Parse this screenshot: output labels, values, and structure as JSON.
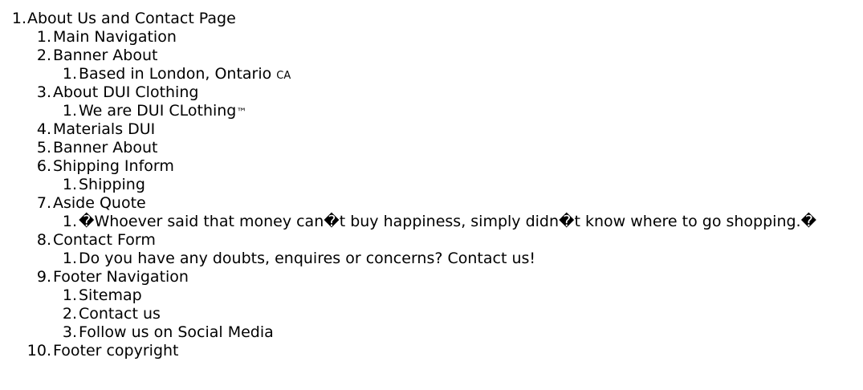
{
  "outline": {
    "title": {
      "num": "1.",
      "text": "About Us and Contact Page"
    },
    "sections": [
      {
        "num": "1.",
        "text": "Main Navigation",
        "children": []
      },
      {
        "num": "2.",
        "text": "Banner About",
        "children": [
          {
            "num": "1.",
            "text": "Based in London, Ontario ",
            "mark": "CA"
          }
        ]
      },
      {
        "num": "3.",
        "text": "About DUI Clothing",
        "children": [
          {
            "num": "1.",
            "text": "We are DUI CLothing",
            "mark": "™"
          }
        ]
      },
      {
        "num": "4.",
        "text": "Materials DUI",
        "children": []
      },
      {
        "num": "5.",
        "text": "Banner About",
        "children": []
      },
      {
        "num": "6.",
        "text": "Shipping Inform",
        "children": [
          {
            "num": "1.",
            "text": "Shipping"
          }
        ]
      },
      {
        "num": "7.",
        "text": "Aside Quote",
        "children": [
          {
            "num": "1.",
            "text": "�Whoever said that money can�t buy happiness, simply didn�t know where to go shopping.�"
          }
        ]
      },
      {
        "num": "8.",
        "text": "Contact Form",
        "children": [
          {
            "num": "1.",
            "text": "Do you have any doubts, enquires or concerns? Contact us!"
          }
        ]
      },
      {
        "num": "9.",
        "text": "Footer Navigation",
        "children": [
          {
            "num": "1.",
            "text": "Sitemap"
          },
          {
            "num": "2.",
            "text": "Contact us"
          },
          {
            "num": "3.",
            "text": "Follow us on Social Media"
          }
        ]
      },
      {
        "num": "10.",
        "text": "Footer copyright",
        "children": []
      }
    ]
  }
}
